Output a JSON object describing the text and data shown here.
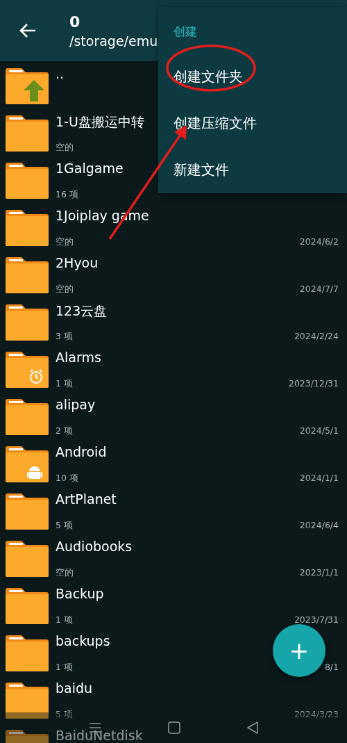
{
  "header": {
    "title": "0",
    "path": "/storage/emu"
  },
  "menu": {
    "heading": "创建",
    "items": [
      {
        "label": "创建文件夹",
        "highlighted": true
      },
      {
        "label": "创建压缩文件",
        "highlighted": false
      },
      {
        "label": "新建文件",
        "highlighted": false
      }
    ]
  },
  "files": [
    {
      "kind": "parent",
      "name": ".."
    },
    {
      "kind": "folder",
      "name": "1-U盘搬运中转",
      "info": "空的"
    },
    {
      "kind": "folder",
      "name": "1Galgame",
      "info": "16 项"
    },
    {
      "kind": "folder",
      "name": "1Joiplay game",
      "info": "空的",
      "date": "2024/6/2"
    },
    {
      "kind": "folder",
      "name": "2Hyou",
      "info": "空的",
      "date": "2024/7/7"
    },
    {
      "kind": "folder",
      "name": "123云盘",
      "info": "3 项",
      "date": "2024/2/24"
    },
    {
      "kind": "alarm",
      "name": "Alarms",
      "info": "1 项",
      "date": "2023/12/31"
    },
    {
      "kind": "folder",
      "name": "alipay",
      "info": "2 项",
      "date": "2024/5/1"
    },
    {
      "kind": "android",
      "name": "Android",
      "info": "10 项",
      "date": "2024/1/1"
    },
    {
      "kind": "folder",
      "name": "ArtPlanet",
      "info": "5 项",
      "date": "2024/6/4"
    },
    {
      "kind": "folder",
      "name": "Audiobooks",
      "info": "空的",
      "date": "2023/1/1"
    },
    {
      "kind": "folder",
      "name": "Backup",
      "info": "1 项",
      "date": "2023/7/31"
    },
    {
      "kind": "folder",
      "name": "backups",
      "info": "1 项",
      "date": "8/1"
    },
    {
      "kind": "folder",
      "name": "baidu",
      "info": "5 项",
      "date": "2024/3/23"
    },
    {
      "kind": "folder",
      "name": "BaiduNetdisk"
    }
  ],
  "fab": {
    "label": "+"
  }
}
